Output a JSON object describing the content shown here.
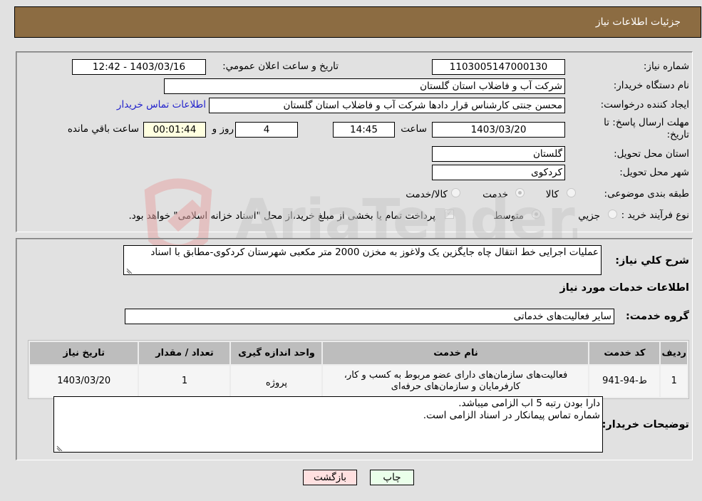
{
  "header": {
    "title": "جزئیات اطلاعات نیاز"
  },
  "form": {
    "need_number_label": "شماره نیاز:",
    "need_number": "1103005147000130",
    "announce_label": "تاریخ و ساعت اعلان عمومي:",
    "announce_value": "1403/03/16 - 12:42",
    "buyer_org_label": "نام دستگاه خریدار:",
    "buyer_org": "شرکت آب و فاضلاب استان گلستان",
    "creator_label": "ایجاد کننده درخواست:",
    "creator": "محسن جنتی کارشناس قرار دادها شرکت آب و فاضلاب استان گلستان",
    "contact_link": "اطلاعات تماس خریدار",
    "deadline_label": "مهلت ارسال پاسخ: تا تاریخ:",
    "deadline_date": "1403/03/20",
    "time_label": "ساعت",
    "deadline_time": "14:45",
    "days_value": "4",
    "days_label": "روز و",
    "remaining_time": "00:01:44",
    "remaining_label": "ساعت باقي مانده",
    "province_label": "استان محل تحویل:",
    "province": "گلستان",
    "city_label": "شهر محل تحویل:",
    "city": "کردکوی",
    "category_label": "طبقه بندی موضوعی:",
    "category_options": [
      {
        "label": "کالا",
        "checked": false
      },
      {
        "label": "خدمت",
        "checked": true
      },
      {
        "label": "کالا/خدمت",
        "checked": false
      }
    ],
    "process_label": "نوع فرآیند خرید :",
    "process_options": [
      {
        "label": "جزيي",
        "checked": false
      },
      {
        "label": "متوسط",
        "checked": true
      }
    ],
    "treasury_note": "پرداخت تمام یا بخشی از مبلغ خرید،از محل \"اسناد خزانه اسلامی\" خواهد بود.",
    "treasury_checked": true
  },
  "details": {
    "description_label": "شرح کلي نیاز:",
    "description": "عملیات اجرایی خط انتقال چاه جایگزین یک ولاغوز به مخزن 2000 متر مکعبی شهرستان کردکوی-مطابق با اسناد",
    "services_heading": "اطلاعات خدمات مورد نیاز",
    "service_group_label": "گروه خدمت:",
    "service_group": "سایر فعالیت‌های خدماتی",
    "table": {
      "columns": [
        "ردیف",
        "کد خدمت",
        "نام خدمت",
        "واحد اندازه گیری",
        "تعداد / مقدار",
        "تاریخ نیاز"
      ],
      "rows": [
        [
          "1",
          "ط-94-941",
          "فعالیت‌های سازمان‌های دارای عضو مربوط به کسب و کار، کارفرمایان و سازمان‌های حرفه‌ای",
          "پروژه",
          "1",
          "1403/03/20"
        ]
      ]
    },
    "buyer_notes_label": "توضیحات خریدار:",
    "buyer_notes_line1": "دارا بودن رتبه 5 اب الزامی میباشد.",
    "buyer_notes_line2": "شماره تماس پیمانکار در اسناد الزامی است."
  },
  "buttons": {
    "print": "چاپ",
    "back": "بازگشت"
  },
  "colors": {
    "header_bg": "#8c6c42",
    "print_bg": "#eaffea",
    "back_bg": "#ffe0e0",
    "link": "#2222cc"
  }
}
